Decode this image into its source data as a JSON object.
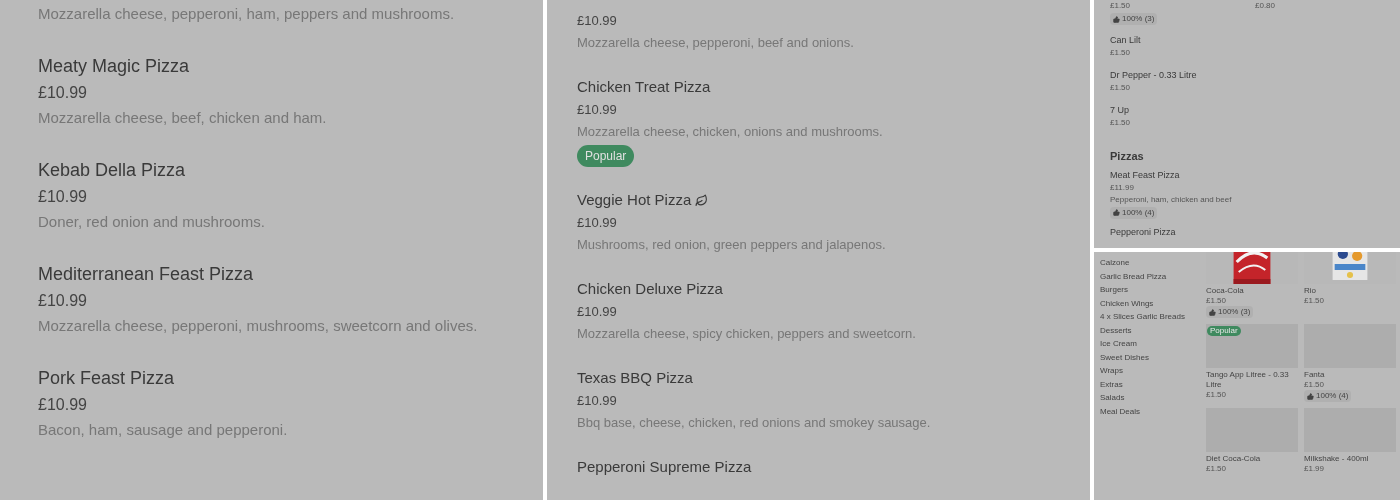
{
  "left_panel": {
    "items": [
      {
        "description": "Mozzarella cheese, pepperoni, ham, peppers and mushrooms."
      },
      {
        "title": "Meaty Magic Pizza",
        "price": "£10.99",
        "description": "Mozzarella cheese, beef, chicken and ham."
      },
      {
        "title": "Kebab Della Pizza",
        "price": "£10.99",
        "description": "Doner, red onion and mushrooms."
      },
      {
        "title": "Mediterranean Feast Pizza",
        "price": "£10.99",
        "description": "Mozzarella cheese, pepperoni, mushrooms, sweetcorn and olives."
      },
      {
        "title": "Pork Feast Pizza",
        "price": "£10.99",
        "description": "Bacon, ham, sausage and pepperoni."
      }
    ]
  },
  "middle_panel": {
    "items": [
      {
        "price": "£10.99",
        "description": "Mozzarella cheese, pepperoni, beef and onions.",
        "vegetarian": false
      },
      {
        "title": "Chicken Treat Pizza",
        "price": "£10.99",
        "description": "Mozzarella cheese, chicken, onions and mushrooms.",
        "badge": "Popular",
        "vegetarian": false
      },
      {
        "title": "Veggie Hot Pizza",
        "price": "£10.99",
        "description": "Mushrooms, red onion, green peppers and jalapenos.",
        "vegetarian": true
      },
      {
        "title": "Chicken Deluxe Pizza",
        "price": "£10.99",
        "description": "Mozzarella cheese, spicy chicken, peppers and sweetcorn.",
        "vegetarian": false
      },
      {
        "title": "Texas BBQ Pizza",
        "price": "£10.99",
        "description": "Bbq base, cheese, chicken, red onions and smokey sausage.",
        "vegetarian": false
      },
      {
        "title": "Pepperoni Supreme Pizza",
        "vegetarian": false
      }
    ]
  },
  "top_right_panel": {
    "top_items": [
      {
        "price": "£1.50",
        "rating": "100% (3)"
      },
      {
        "price": "£0.80"
      }
    ],
    "items": [
      {
        "name": "Can Lilt",
        "price": "£1.50"
      },
      {
        "name": "Dr Pepper - 0.33 Litre",
        "price": "£1.50"
      },
      {
        "name": "7 Up",
        "price": "£1.50"
      }
    ],
    "section": {
      "heading": "Pizzas",
      "items": [
        {
          "name": "Meat Feast Pizza",
          "price": "£11.99",
          "description": "Pepperoni, ham, chicken and beef",
          "rating": "100% (4)"
        },
        {
          "name": "Pepperoni Pizza"
        }
      ]
    }
  },
  "bottom_right_panel": {
    "categories": [
      "Calzone",
      "Garlic Bread Pizza",
      "Burgers",
      "Chicken Wings",
      "4 x Slices Garlic Breads",
      "Desserts",
      "Ice Cream",
      "Sweet Dishes",
      "Wraps",
      "Extras",
      "Salads",
      "Meal Deals"
    ],
    "products": [
      {
        "name": "Coca-Cola",
        "price": "£1.50",
        "rating": "100% (3)",
        "kind": "picture"
      },
      {
        "name": "Rio",
        "price": "£1.50",
        "kind": "picture"
      },
      {
        "name": "Tango App Litree - 0.33 Litre",
        "price": "£1.50",
        "badge": "Popular",
        "kind": "placeholder"
      },
      {
        "name": "Fanta",
        "price": "£1.50",
        "rating": "100% (4)",
        "kind": "placeholder"
      },
      {
        "name": "Diet Coca-Cola",
        "price": "£1.50",
        "kind": "placeholder"
      },
      {
        "name": "Milkshake - 400ml",
        "price": "£1.99",
        "kind": "placeholder"
      }
    ]
  }
}
